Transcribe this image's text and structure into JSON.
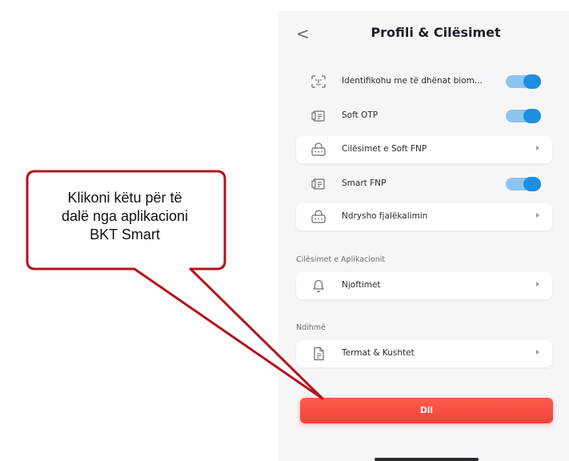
{
  "header": {
    "back_glyph": "<",
    "title": "Profili & Cilësimet"
  },
  "settings": {
    "items": [
      {
        "label": "Identifikohu me të dhënat biom...",
        "icon": "face-id-icon",
        "control": "toggle",
        "on": true
      },
      {
        "label": "Soft OTP",
        "icon": "otp-icon",
        "control": "toggle",
        "on": true
      },
      {
        "label": "Cilësimet e Soft FNP",
        "icon": "password-icon",
        "control": "chevron"
      },
      {
        "label": "Smart FNP",
        "icon": "otp-icon",
        "control": "toggle",
        "on": true
      },
      {
        "label": "Ndrysho fjalëkalimin",
        "icon": "password-icon",
        "control": "chevron"
      }
    ]
  },
  "app_settings": {
    "section_label": "Cilësimet e Aplikacionit",
    "items": [
      {
        "label": "Njoftimet",
        "icon": "bell-icon",
        "control": "chevron"
      }
    ]
  },
  "help": {
    "section_label": "Ndihmë",
    "items": [
      {
        "label": "Termat & Kushtet",
        "icon": "document-icon",
        "control": "chevron"
      }
    ]
  },
  "logout": {
    "label": "Dil"
  },
  "callout": {
    "lines": [
      "Klikoni këtu për të",
      "dalë nga aplikacioni",
      "BKT Smart"
    ]
  },
  "colors": {
    "toggle_on": "#1e8fe0",
    "toggle_track": "#8dc4ee",
    "logout": "#f0443a",
    "callout_border": "#b3141b"
  }
}
